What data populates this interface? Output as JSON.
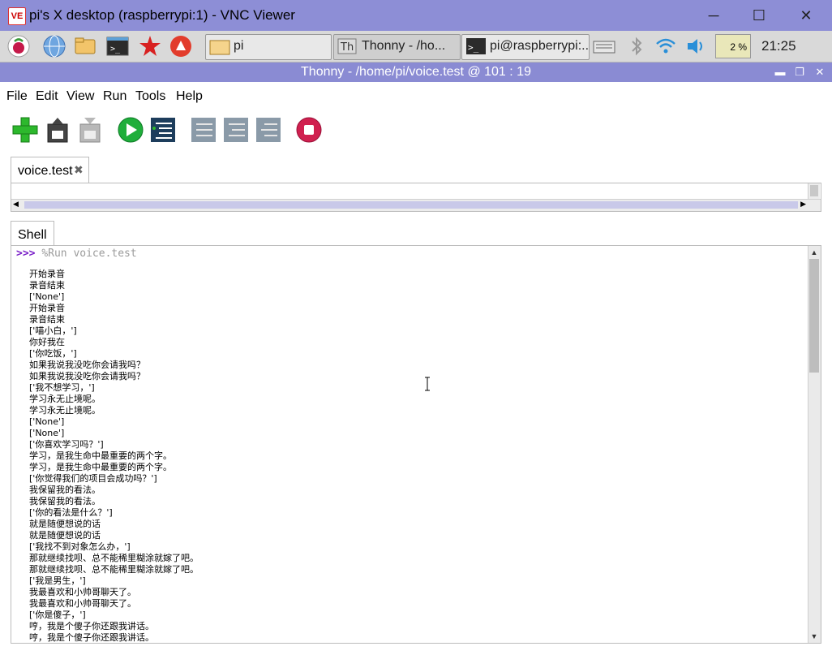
{
  "vnc": {
    "logo_text": "VE",
    "title": "pi's X desktop (raspberrypi:1) - VNC Viewer",
    "minimize": "─",
    "maximize": "☐",
    "close": "✕"
  },
  "taskbar": {
    "tasks": [
      {
        "label": "pi",
        "icon": "folder-icon"
      },
      {
        "label": "Thonny  -  /ho...",
        "icon": "thonny-icon"
      },
      {
        "label": "pi@raspberrypi:...",
        "icon": "terminal-icon"
      }
    ],
    "cpu": "2 %",
    "clock": "21:25"
  },
  "thonny": {
    "title": "Thonny  -  /home/pi/voice.test  @  101 : 19",
    "minimize": "▬",
    "restore": "❐",
    "close": "✕"
  },
  "menu": [
    "File",
    "Edit",
    "View",
    "Run",
    "Tools",
    "Help"
  ],
  "editor": {
    "tab_label": "voice.test"
  },
  "shell": {
    "tab_label": "Shell",
    "prompt": ">>>",
    "command": "%Run voice.test",
    "output": [
      "开始录音",
      "录音结束",
      "['None']",
      "开始录音",
      "录音结束",
      "['喵小白，']",
      "你好我在",
      "['你吃饭，']",
      "如果我说我没吃你会请我吗？",
      "如果我说我没吃你会请我吗？",
      "['我不想学习，']",
      "学习永无止境呢。",
      "学习永无止境呢。",
      "['None']",
      "['None']",
      "['你喜欢学习吗？']",
      "学习，是我生命中最重要的两个字。",
      "学习，是我生命中最重要的两个字。",
      "['你觉得我们的项目会成功吗？']",
      "我保留我的看法。",
      "我保留我的看法。",
      "['你的看法是什么？']",
      "就是随便想说的话",
      "就是随便想说的话",
      "['我找不到对象怎么办，']",
      "那就继续找呗、总不能稀里糊涂就嫁了吧。",
      "那就继续找呗、总不能稀里糊涂就嫁了吧。",
      "['我是男生，']",
      "我最喜欢和小帅哥聊天了。",
      "我最喜欢和小帅哥聊天了。",
      "['你是傻子，']",
      "哼，我是个傻子你还跟我讲话。",
      "哼，我是个傻子你还跟我讲话。"
    ]
  },
  "colors": {
    "titlebar": "#8d8ed6",
    "prompt": "#7a20c8",
    "run_button": "#1fae3b",
    "stop_button": "#d0204f"
  }
}
